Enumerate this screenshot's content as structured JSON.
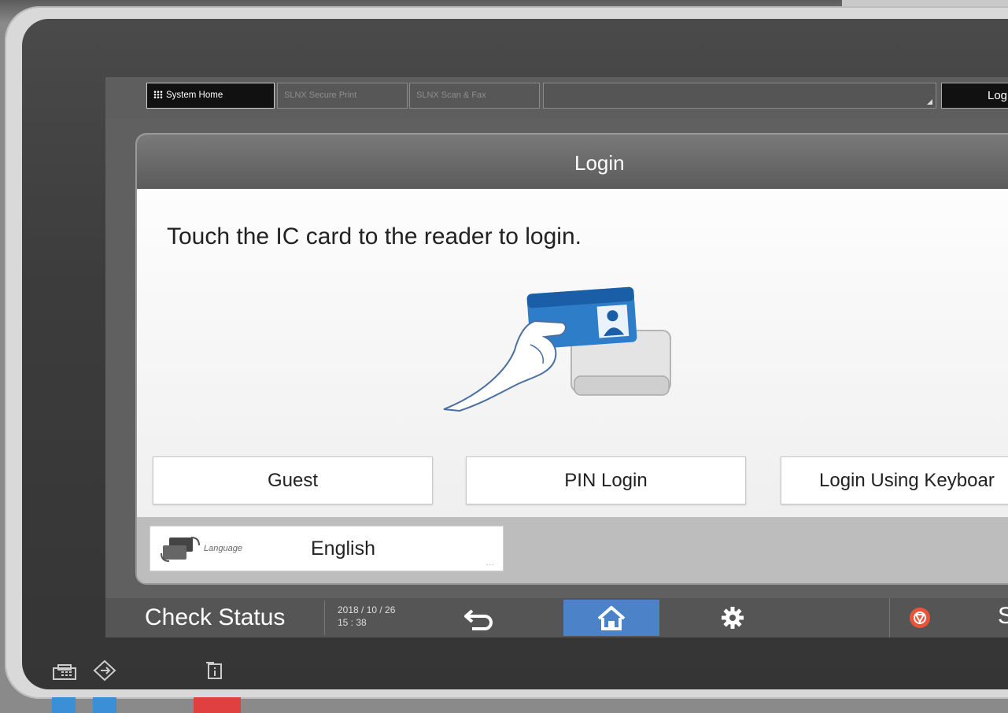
{
  "appbar": {
    "tabs": [
      {
        "label": "System Home",
        "active": true
      },
      {
        "label": "SLNX Secure Print",
        "active": false
      },
      {
        "label": "SLNX Scan & Fax",
        "active": false
      }
    ],
    "login_button": "Log"
  },
  "dialog": {
    "title": "Login",
    "prompt": "Touch the IC card to the reader to login.",
    "buttons": [
      "Guest",
      "PIN Login",
      "Login Using Keyboar"
    ],
    "language": {
      "label": "Language",
      "value": "English",
      "more": "..."
    }
  },
  "statusbar": {
    "check_status": "Check Status",
    "date": "2018 / 10 / 26",
    "time": "15 : 38",
    "right_cut_text": "S",
    "home_color": "#4b82c8"
  },
  "icons": [
    "grid-icon",
    "ic-card-reader-icon",
    "language-icon",
    "back-arrow-icon",
    "home-icon",
    "gear-icon",
    "stop-icon",
    "printer-icon",
    "energy-saver-icon",
    "info-icon"
  ],
  "led_colors": {
    "blue": "#3b8fd6",
    "red": "#e04040"
  }
}
